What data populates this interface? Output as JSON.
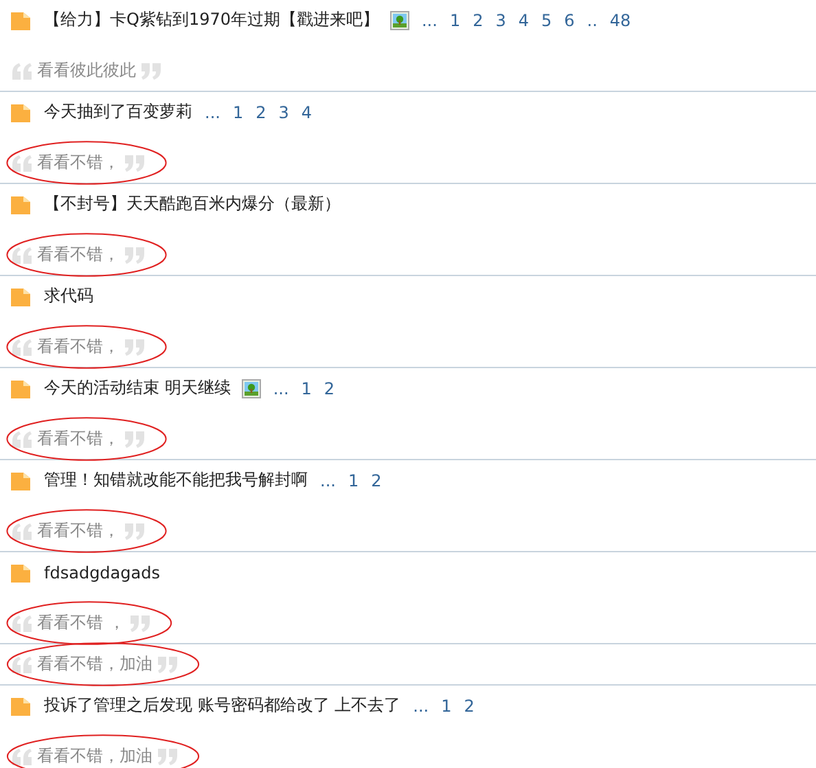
{
  "threads": [
    {
      "title": "【给力】卡Q紫钻到1970年过期【戳进来吧】",
      "image": true,
      "pages": [
        "...",
        "1",
        "2",
        "3",
        "4",
        "5",
        "6",
        "..",
        "48"
      ],
      "comments": [
        {
          "text": "看看彼此彼此",
          "circled": false
        }
      ]
    },
    {
      "title": "今天抽到了百变萝莉",
      "image": false,
      "pages": [
        "...",
        "1",
        "2",
        "3",
        "4"
      ],
      "comments": [
        {
          "text": "看看不错，",
          "circled": true
        }
      ]
    },
    {
      "title": "【不封号】天天酷跑百米内爆分（最新）",
      "image": false,
      "comments": [
        {
          "text": "看看不错，",
          "circled": true
        }
      ]
    },
    {
      "title": "求代码",
      "image": false,
      "comments": [
        {
          "text": "看看不错，",
          "circled": true
        }
      ]
    },
    {
      "title": "今天的活动结束 明天继续",
      "image": true,
      "pages": [
        "...",
        "1",
        "2"
      ],
      "comments": [
        {
          "text": "看看不错，",
          "circled": true
        }
      ]
    },
    {
      "title": "管理！知错就改能不能把我号解封啊",
      "image": false,
      "pages": [
        "...",
        "1",
        "2"
      ],
      "comments": [
        {
          "text": "看看不错，",
          "circled": true
        }
      ]
    },
    {
      "title": "fdsadgdagads",
      "image": false,
      "comments": [
        {
          "text": "看看不错 ，",
          "circled": true
        },
        {
          "text": "看看不错，加油",
          "circled": true
        }
      ]
    },
    {
      "title": "投诉了管理之后发现 账号密码都给改了 上不去了",
      "image": false,
      "pages": [
        "...",
        "1",
        "2"
      ],
      "comments": [
        {
          "text": "看看不错，加油",
          "circled": true
        }
      ]
    }
  ]
}
